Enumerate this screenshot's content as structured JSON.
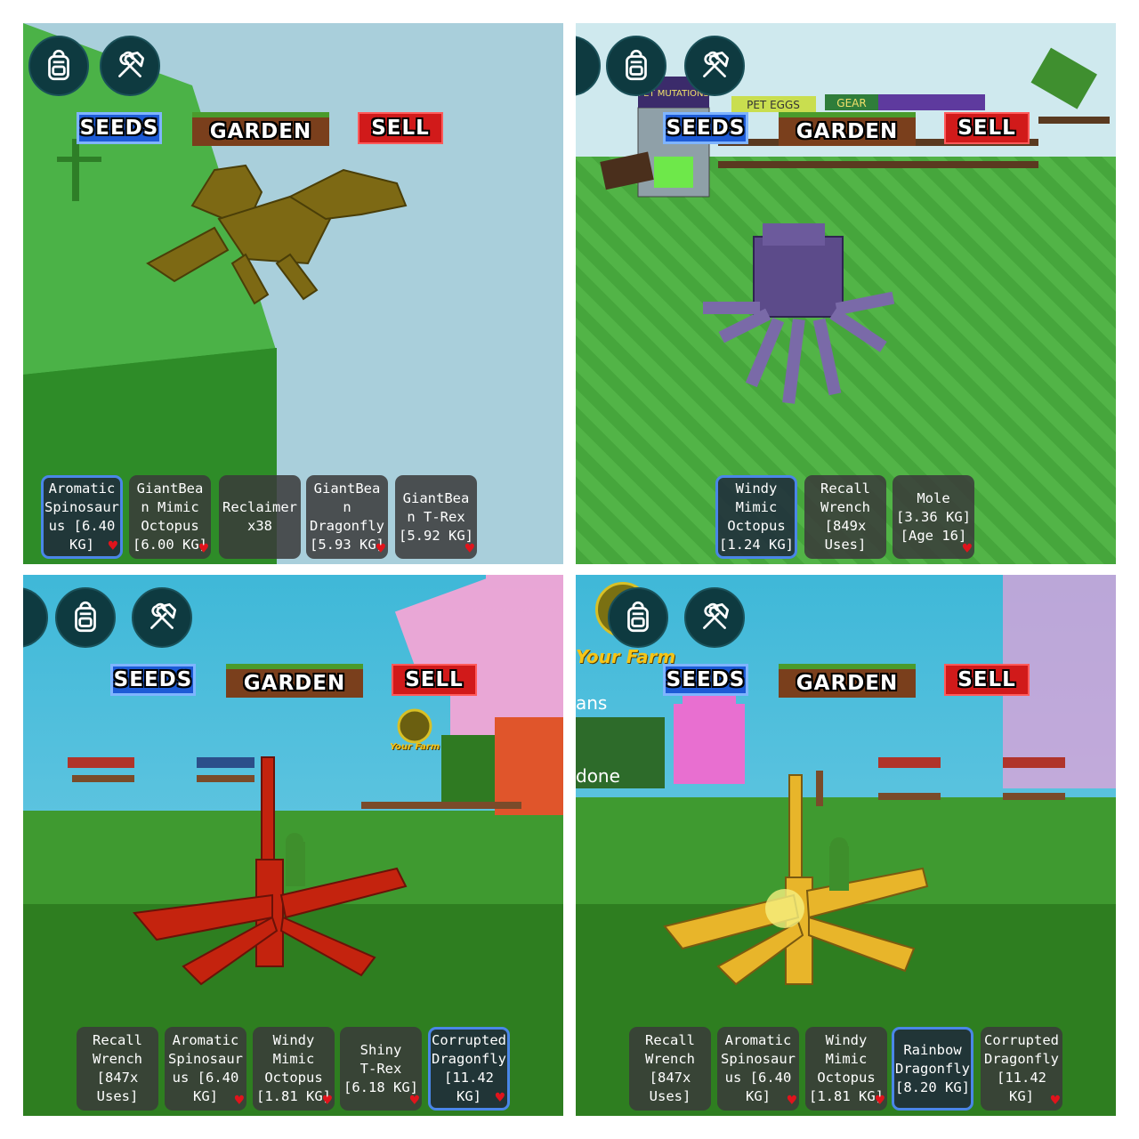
{
  "buttons": {
    "seeds": "SEEDS",
    "garden": "GARDEN",
    "sell": "SELL"
  },
  "panels": [
    {
      "hotbar": [
        {
          "label": "Aromatic\nSpinosaur\nus [6.40\nKG]",
          "selected": true,
          "favorite": true
        },
        {
          "label": "GiantBea\nn Mimic\nOctopus\n[6.00 KG]",
          "selected": false,
          "favorite": true
        },
        {
          "label": "Reclaimer\nx38",
          "selected": false,
          "favorite": false
        },
        {
          "label": "GiantBea\nn\nDragonfly\n[5.93 KG]",
          "selected": false,
          "favorite": true
        },
        {
          "label": "GiantBea\nn T-Rex\n[5.92 KG]",
          "selected": false,
          "favorite": true
        }
      ]
    },
    {
      "signs": {
        "pet_mutations": "PET MUTATIONS",
        "pet_eggs": "PET EGGS",
        "gear": "GEAR"
      },
      "hotbar": [
        {
          "label": "Windy\nMimic\nOctopus\n[1.24 KG]",
          "selected": true,
          "favorite": false
        },
        {
          "label": "Recall\nWrench\n[849x\nUses]",
          "selected": false,
          "favorite": false
        },
        {
          "label": "Mole\n[3.36 KG]\n[Age 16]",
          "selected": false,
          "favorite": true
        }
      ]
    },
    {
      "farm_label": "Your Farm",
      "hotbar": [
        {
          "label": "Recall\nWrench\n[847x\nUses]",
          "selected": false,
          "favorite": false
        },
        {
          "label": "Aromatic\nSpinosaur\nus [6.40\nKG]",
          "selected": false,
          "favorite": true
        },
        {
          "label": "Windy\nMimic\nOctopus\n[1.81 KG]",
          "selected": false,
          "favorite": true
        },
        {
          "label": "Shiny\nT-Rex\n[6.18 KG]",
          "selected": false,
          "favorite": true
        },
        {
          "label": "Corrupted\nDragonfly\n[11.42 KG]",
          "selected": true,
          "favorite": true
        }
      ]
    },
    {
      "farm_label": "Your Farm",
      "side_text_1": "ans",
      "side_text_2": "done",
      "hotbar": [
        {
          "label": "Recall\nWrench\n[847x\nUses]",
          "selected": false,
          "favorite": false
        },
        {
          "label": "Aromatic\nSpinosaur\nus [6.40\nKG]",
          "selected": false,
          "favorite": true
        },
        {
          "label": "Windy\nMimic\nOctopus\n[1.81 KG]",
          "selected": false,
          "favorite": true
        },
        {
          "label": "Rainbow\nDragonfly\n[8.20 KG]",
          "selected": true,
          "favorite": false
        },
        {
          "label": "Corrupted\nDragonfly\n[11.42 KG]",
          "selected": false,
          "favorite": true
        }
      ]
    }
  ],
  "icons": {
    "backpack": "backpack-icon",
    "tools": "hammer-wrench-icon",
    "heart": "heart-icon"
  },
  "colors": {
    "seeds": "#1d5bd6",
    "garden": "#7a3f1c",
    "sell": "#d11a1a",
    "selected_border": "#4a86e8",
    "favorite": "#e0141c"
  }
}
